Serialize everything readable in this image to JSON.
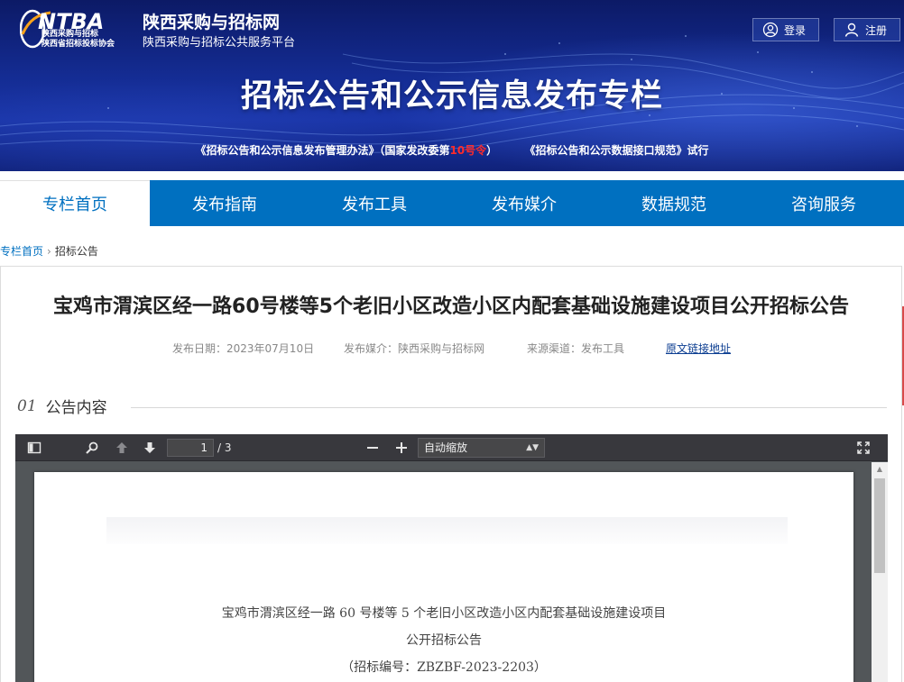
{
  "header": {
    "logo_text": "NTBA",
    "logo_sub1": "陕西采购与招标",
    "logo_sub2": "陕西省招标投标协会",
    "site_name": "陕西采购与招标网",
    "site_subtitle": "陕西采购与招标公共服务平台",
    "login_label": "登录",
    "register_label": "注册",
    "banner_title": "招标公告和公示信息发布专栏",
    "notice_part1": "《招标公告和公示信息发布管理办法》（国家发改委第",
    "notice_red": "10号令",
    "notice_part2": "）",
    "notice_part3": "《招标公告和公示数据接口规范》试行"
  },
  "nav": {
    "items": [
      {
        "label": "专栏首页",
        "active": true
      },
      {
        "label": "发布指南"
      },
      {
        "label": "发布工具"
      },
      {
        "label": "发布媒介"
      },
      {
        "label": "数据规范"
      },
      {
        "label": "咨询服务"
      }
    ]
  },
  "breadcrumb": {
    "home": "专栏首页",
    "current": "招标公告"
  },
  "article": {
    "title": "宝鸡市渭滨区经一路60号楼等5个老旧小区改造小区内配套基础设施建设项目公开招标公告",
    "publish_date": "发布日期：2023年07月10日",
    "media": "发布媒介：陕西采购与招标网",
    "source": "来源渠道：发布工具",
    "original_link": "原文链接地址"
  },
  "section": {
    "number": "01",
    "label": "公告内容"
  },
  "pdf_viewer": {
    "current_page": "1",
    "total_pages": "/ 3",
    "zoom_label": "自动缩放",
    "page_line1": "宝鸡市渭滨区经一路 60 号楼等 5 个老旧小区改造小区内配套基础设施建设项目",
    "page_line2": "公开招标公告",
    "page_line3": "（招标编号：ZBZBF-2023-2203）"
  },
  "colors": {
    "nav_blue": "#0070c0",
    "banner_blue": "#142c93",
    "notice_red": "#ff2b2b",
    "link_blue": "#0b3d91"
  }
}
